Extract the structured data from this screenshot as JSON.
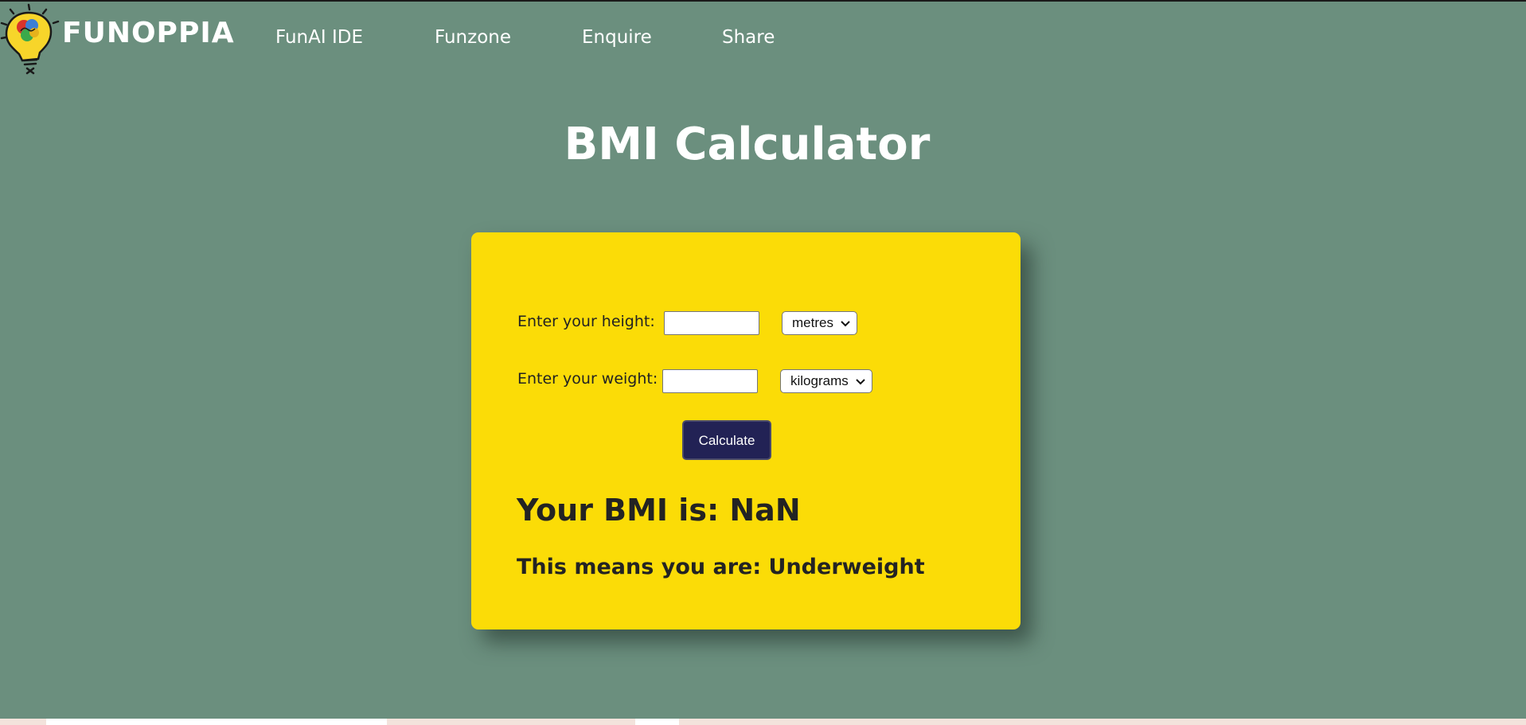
{
  "brand": {
    "name": "FUNOPPIA",
    "logo_icon": "lightbulb-brain-icon"
  },
  "nav": {
    "links": [
      "FunAI IDE",
      "Funzone",
      "Enquire",
      "Share"
    ]
  },
  "page": {
    "title": "BMI Calculator"
  },
  "form": {
    "height_label": "Enter your height:",
    "height_value": "",
    "height_unit": "metres",
    "weight_label": "Enter your weight:",
    "weight_value": "",
    "weight_unit": "kilograms",
    "calculate_label": "Calculate"
  },
  "result": {
    "bmi_text": "Your BMI is: NaN",
    "category_text": "This means you are: Underweight"
  },
  "colors": {
    "background": "#6b8f7e",
    "card": "#fbdc07",
    "button": "#222255",
    "text_dark": "#232323",
    "text_light": "#ffffff"
  }
}
